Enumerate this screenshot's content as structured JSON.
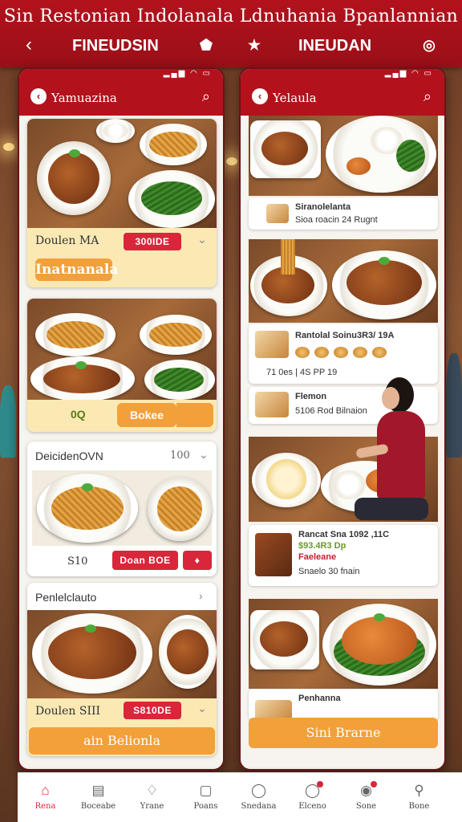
{
  "banner": {
    "title": "Sin Restonian Indolanala Ldnuhania Bpanlannian",
    "back_icon": "chevron-left-icon",
    "left_label": "FINEUDSIN",
    "right_label": "INEUDAN",
    "icons": [
      "tag-icon",
      "star-icon",
      "camera-icon"
    ]
  },
  "left_phone": {
    "status": "▂▄▆ ◠ ▭",
    "header_title": "Yamuazina",
    "card1": {
      "label": "Doulen MA",
      "price": "300IDE",
      "cta": "Inatnanala"
    },
    "card2": {
      "price": "0Q",
      "cta": "Bokee"
    },
    "card3": {
      "title": "DeicidenOVN",
      "count": "100",
      "price": "S10",
      "button": "Doan BOE"
    },
    "card4": {
      "title": "Penlelclauto",
      "label": "Doulen SIII",
      "price": "S810DE",
      "cta": "ain Belionla"
    }
  },
  "right_phone": {
    "status": "▂▄▆ ◠ ▭",
    "header_title": "Yelaula",
    "row1": {
      "title": "Siranolelanta",
      "sub": "Sioa roacin 24 Rugnt"
    },
    "row2": {
      "title": "Rantolal Soinu3R3/ 19A",
      "meta": "71   0es | 4S  PP   19"
    },
    "row3": {
      "title": "Flemon",
      "sub": "5106 Rod  Bilnaion"
    },
    "row4": {
      "title": "Rancat Sna 1092 ,11C",
      "price": "$93.4R3 Dp",
      "tag": "Faeleane",
      "sub": "Snaelo  30 fnain"
    },
    "row5": {
      "title": "Penhanna"
    },
    "cta": "Sini Brarne"
  },
  "tabbar": [
    {
      "label": "Rena",
      "icon": "home-icon"
    },
    {
      "label": "Boceabe",
      "icon": "document-icon"
    },
    {
      "label": "Yrane",
      "icon": "bell-icon"
    },
    {
      "label": "Poans",
      "icon": "chat-icon"
    },
    {
      "label": "Snedana",
      "icon": "message-icon"
    },
    {
      "label": "Elceno",
      "icon": "notification-icon"
    },
    {
      "label": "Sone",
      "icon": "pin-icon"
    },
    {
      "label": "Bone",
      "icon": "profile-icon"
    }
  ]
}
